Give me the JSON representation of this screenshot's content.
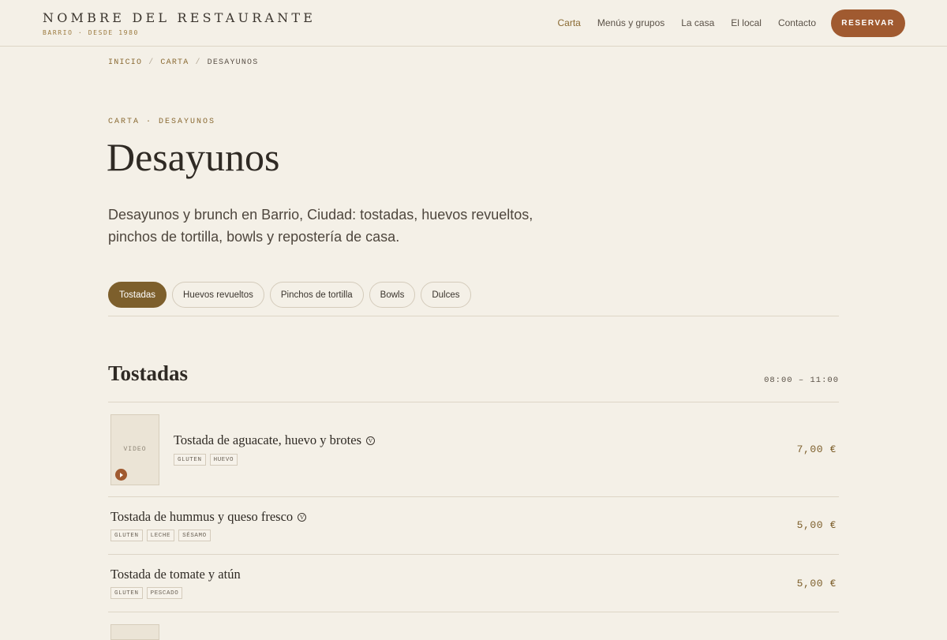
{
  "header": {
    "brand_name": "NOMBRE DEL RESTAURANTE",
    "brand_sub": "BARRIO · DESDE 1980",
    "nav": [
      "Carta",
      "Menús y grupos",
      "La casa",
      "El local",
      "Contacto"
    ],
    "reserve_label": "RESERVAR"
  },
  "breadcrumb": {
    "items": [
      "INICIO",
      "CARTA",
      "DESAYUNOS"
    ],
    "separator": "/"
  },
  "page": {
    "eyebrow": "CARTA · DESAYUNOS",
    "title": "Desayunos",
    "intro": "Desayunos y brunch en Barrio, Ciudad: tostadas, huevos revueltos, pinchos de tortilla, bowls y repostería de casa."
  },
  "tabs": [
    {
      "label": "Tostadas",
      "active": true
    },
    {
      "label": "Huevos revueltos",
      "active": false
    },
    {
      "label": "Pinchos de tortilla",
      "active": false
    },
    {
      "label": "Bowls",
      "active": false
    },
    {
      "label": "Dulces",
      "active": false
    }
  ],
  "section": {
    "title": "Tostadas",
    "hours": "08:00 – 11:00",
    "items": [
      {
        "name": "Tostada de aguacate, huevo y brotes",
        "badge": "V",
        "allergens": [
          "GLUTEN",
          "HUEVO"
        ],
        "price": "7,00 €",
        "thumb_label": "VIDEO"
      },
      {
        "name": "Tostada de hummus y queso fresco",
        "badge": "V",
        "allergens": [
          "GLUTEN",
          "LECHE",
          "SÉSAMO"
        ],
        "price": "5,00 €"
      },
      {
        "name": "Tostada de tomate y atún",
        "allergens": [
          "GLUTEN",
          "PESCADO"
        ],
        "price": "5,00 €"
      }
    ]
  },
  "colors": {
    "background": "#f4f0e7",
    "accent": "#a05a30",
    "active_tab": "#7d5f2c",
    "gold": "#8a6a33"
  },
  "icons": [
    "play-icon",
    "vegetarian-icon"
  ]
}
